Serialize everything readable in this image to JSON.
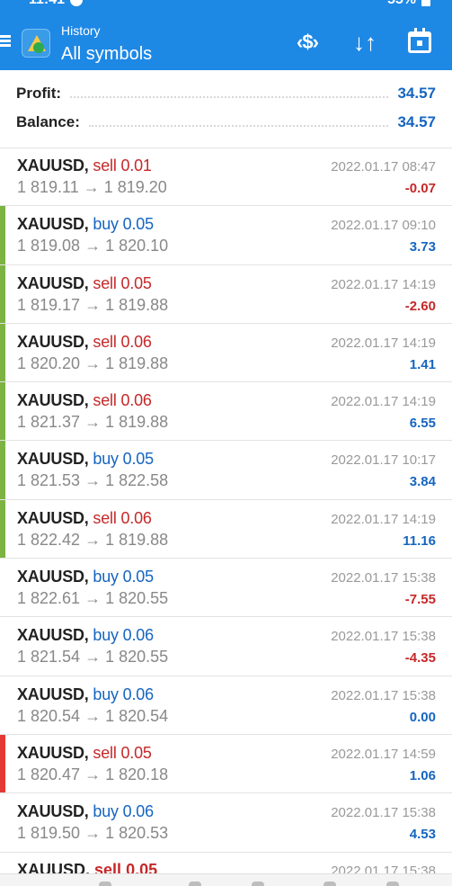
{
  "status_bar": {
    "time": "11:41",
    "battery": "55%"
  },
  "app_bar": {
    "subtitle": "History",
    "title": "All symbols",
    "currency_icon_glyph": "‹$›",
    "sort_icon_glyph": "↓↑"
  },
  "summary": {
    "profit_label": "Profit:",
    "profit_value": "34.57",
    "balance_label": "Balance:",
    "balance_value": "34.57"
  },
  "trades": [
    {
      "symbol": "XAUUSD,",
      "side": "sell",
      "volume": "0.01",
      "prices": "1 819.11 → 1 819.20",
      "time": "2022.01.17 08:47",
      "profit": "-0.07",
      "marker": "none"
    },
    {
      "symbol": "XAUUSD,",
      "side": "buy",
      "volume": "0.05",
      "prices": "1 819.08 → 1 820.10",
      "time": "2022.01.17 09:10",
      "profit": "3.73",
      "marker": "green"
    },
    {
      "symbol": "XAUUSD,",
      "side": "sell",
      "volume": "0.05",
      "prices": "1 819.17 → 1 819.88",
      "time": "2022.01.17 14:19",
      "profit": "-2.60",
      "marker": "green"
    },
    {
      "symbol": "XAUUSD,",
      "side": "sell",
      "volume": "0.06",
      "prices": "1 820.20 → 1 819.88",
      "time": "2022.01.17 14:19",
      "profit": "1.41",
      "marker": "green"
    },
    {
      "symbol": "XAUUSD,",
      "side": "sell",
      "volume": "0.06",
      "prices": "1 821.37 → 1 819.88",
      "time": "2022.01.17 14:19",
      "profit": "6.55",
      "marker": "green"
    },
    {
      "symbol": "XAUUSD,",
      "side": "buy",
      "volume": "0.05",
      "prices": "1 821.53 → 1 822.58",
      "time": "2022.01.17 10:17",
      "profit": "3.84",
      "marker": "green"
    },
    {
      "symbol": "XAUUSD,",
      "side": "sell",
      "volume": "0.06",
      "prices": "1 822.42 → 1 819.88",
      "time": "2022.01.17 14:19",
      "profit": "11.16",
      "marker": "green"
    },
    {
      "symbol": "XAUUSD,",
      "side": "buy",
      "volume": "0.05",
      "prices": "1 822.61 → 1 820.55",
      "time": "2022.01.17 15:38",
      "profit": "-7.55",
      "marker": "none"
    },
    {
      "symbol": "XAUUSD,",
      "side": "buy",
      "volume": "0.06",
      "prices": "1 821.54 → 1 820.55",
      "time": "2022.01.17 15:38",
      "profit": "-4.35",
      "marker": "none"
    },
    {
      "symbol": "XAUUSD,",
      "side": "buy",
      "volume": "0.06",
      "prices": "1 820.54 → 1 820.54",
      "time": "2022.01.17 15:38",
      "profit": "0.00",
      "marker": "none"
    },
    {
      "symbol": "XAUUSD,",
      "side": "sell",
      "volume": "0.05",
      "prices": "1 820.47 → 1 820.18",
      "time": "2022.01.17 14:59",
      "profit": "1.06",
      "marker": "red"
    },
    {
      "symbol": "XAUUSD,",
      "side": "buy",
      "volume": "0.06",
      "prices": "1 819.50 → 1 820.53",
      "time": "2022.01.17 15:38",
      "profit": "4.53",
      "marker": "none"
    }
  ],
  "partial_row": {
    "symbol": "XAUUSD,",
    "side": "sell",
    "volume": "0.05",
    "time": "2022.01.17 15:38"
  },
  "colors": {
    "header_bg": "#1e88e5",
    "sell": "#c62828",
    "buy": "#1565c0",
    "profit_negative": "#c62828",
    "profit_positive": "#1565c0",
    "marker_green": "#7cb342",
    "marker_red": "#e53935"
  },
  "icons": [
    "menu-icon",
    "app-logo-icon",
    "currency-switch-icon",
    "sort-icon",
    "calendar-icon"
  ]
}
